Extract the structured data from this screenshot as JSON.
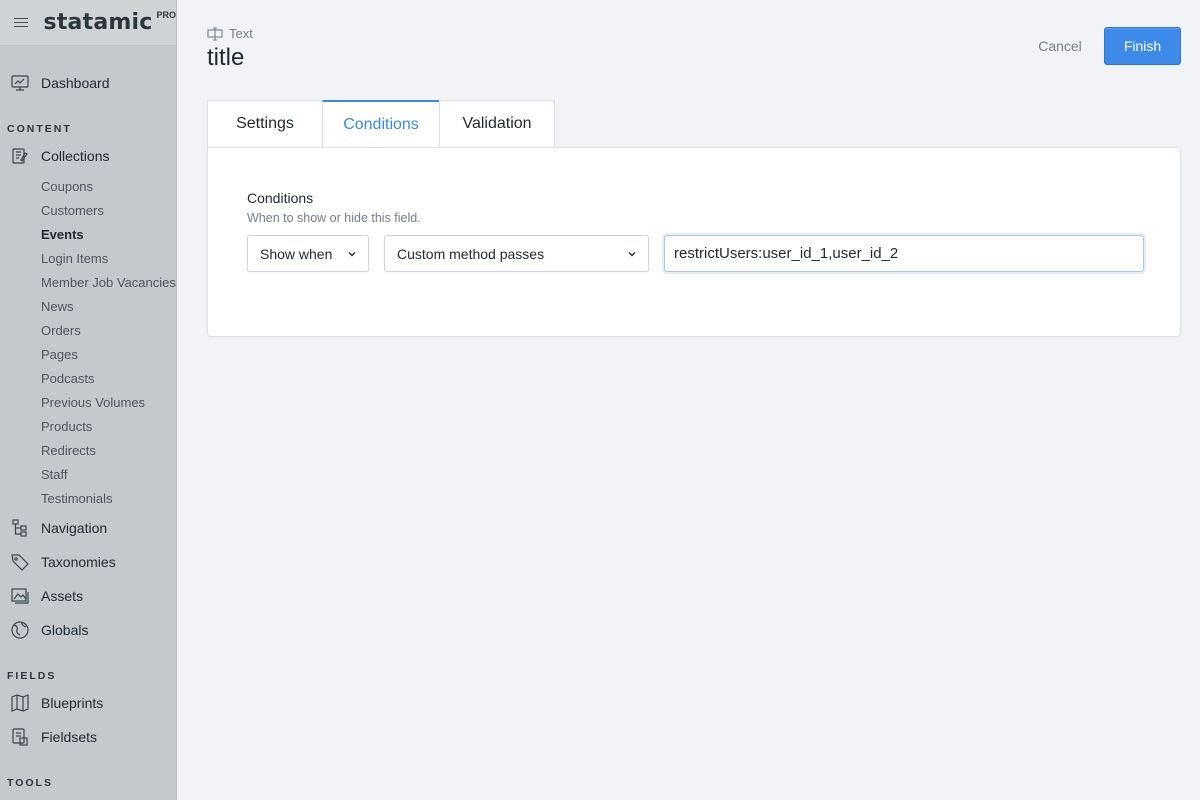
{
  "brand": {
    "name": "statamic",
    "edition": "PRO"
  },
  "sidebar": {
    "dashboard": "Dashboard",
    "content_heading": "CONTENT",
    "collections": "Collections",
    "collection_items": [
      "Coupons",
      "Customers",
      "Events",
      "Login Items",
      "Member Job Vacancies",
      "News",
      "Orders",
      "Pages",
      "Podcasts",
      "Previous Volumes",
      "Products",
      "Redirects",
      "Staff",
      "Testimonials"
    ],
    "active_collection": "Events",
    "navigation": "Navigation",
    "taxonomies": "Taxonomies",
    "assets": "Assets",
    "globals": "Globals",
    "fields_heading": "FIELDS",
    "blueprints": "Blueprints",
    "fieldsets": "Fieldsets",
    "tools_heading": "TOOLS"
  },
  "header": {
    "field_type": "Text",
    "title": "title",
    "cancel_label": "Cancel",
    "finish_label": "Finish"
  },
  "tabs": [
    {
      "label": "Settings",
      "active": false
    },
    {
      "label": "Conditions",
      "active": true
    },
    {
      "label": "Validation",
      "active": false
    }
  ],
  "conditions": {
    "label": "Conditions",
    "help": "When to show or hide this field.",
    "when_select": "Show when",
    "method_select": "Custom method passes",
    "custom_value": "restrictUsers:user_id_1,user_id_2"
  },
  "colors": {
    "accent": "#3a8ad8",
    "primary_button": "#3d8ae8"
  }
}
